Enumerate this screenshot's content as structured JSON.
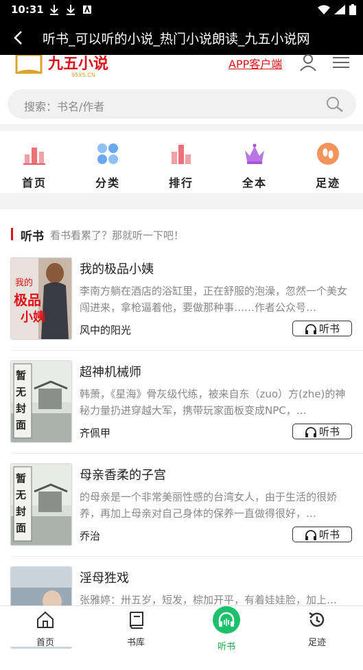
{
  "status_bar": {
    "time": "10:31"
  },
  "title_bar": {
    "title": "听书_可以听的小说_热门小说朗读_九五小说网"
  },
  "header": {
    "app_link": "APP客户端",
    "logo_text": "九五小说",
    "logo_sub": "95XS.CN"
  },
  "search": {
    "placeholder": "搜索：书名/作者"
  },
  "nav": [
    {
      "label": "首页",
      "icon": "bar-chart-icon"
    },
    {
      "label": "分类",
      "icon": "grid-dots-icon"
    },
    {
      "label": "排行",
      "icon": "ranking-icon"
    },
    {
      "label": "全本",
      "icon": "crown-icon"
    },
    {
      "label": "足迹",
      "icon": "footprint-icon"
    }
  ],
  "section": {
    "title": "听书",
    "subtitle": "看书看累了？那就听一下吧！"
  },
  "books": [
    {
      "name": "我的极品小姨",
      "desc": "李南方躺在酒店的浴缸里，正在舒服的泡澡，忽然一个美女闯进来，拿枪逼着他，要做那种事……作者公众号…",
      "author": "风中的阳光",
      "listen": "听书",
      "cover_text": "极品小姨",
      "cover_top": "我的"
    },
    {
      "name": "超神机械师",
      "desc": "韩萧，《星海》骨灰级代练，被来自东（zuo）方(zhe)的神秘力量扔进穿越大军，携带玩家面板变成NPC，…",
      "author": "齐佩甲",
      "listen": "听书",
      "cover_text": "暂无封面"
    },
    {
      "name": "母亲香柔的子宫",
      "desc": "的母亲是一个非常美丽性感的台湾女人，由于生活的很娇养，再加上母亲对自己身体的保养一直做得很好，…",
      "author": "乔治",
      "listen": "听书",
      "cover_text": "暂无封面"
    },
    {
      "name": "淫母狌戏",
      "desc": "张雅婷：卅五岁，短发，棕加开平，有着娃娃脸，加上…",
      "author": "",
      "listen": "",
      "cover_text": ""
    }
  ],
  "tabs": [
    {
      "label": "首页",
      "icon": "home-icon"
    },
    {
      "label": "书库",
      "icon": "book-icon"
    },
    {
      "label": "听书",
      "icon": "headphones-icon",
      "active": true
    },
    {
      "label": "足迹",
      "icon": "history-icon"
    }
  ],
  "colors": {
    "accent_red": "#e0101a",
    "active_green": "#1cc06b",
    "nav_pink": "#f07078",
    "nav_blue": "#6aa7ee",
    "nav_purple": "#a855d8",
    "nav_orange": "#f4935a"
  }
}
